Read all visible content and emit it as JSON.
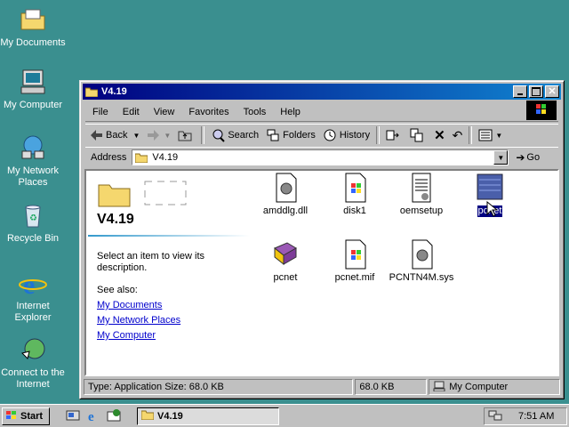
{
  "desktop": {
    "icons": [
      {
        "label": "My Documents",
        "icon": "folder-documents-icon"
      },
      {
        "label": "My Computer",
        "icon": "computer-icon"
      },
      {
        "label": "My Network Places",
        "icon": "network-icon"
      },
      {
        "label": "Recycle Bin",
        "icon": "recycle-bin-icon"
      },
      {
        "label": "Internet Explorer",
        "icon": "internet-explorer-icon"
      },
      {
        "label": "Connect to the Internet",
        "icon": "connect-internet-icon"
      }
    ]
  },
  "window": {
    "title": "V4.19",
    "menu": [
      "File",
      "Edit",
      "View",
      "Favorites",
      "Tools",
      "Help"
    ],
    "toolbar": {
      "back": "Back",
      "search": "Search",
      "folders": "Folders",
      "history": "History"
    },
    "address": {
      "label": "Address",
      "value": "V4.19",
      "go": "Go"
    },
    "sidebar": {
      "folder_name": "V4.19",
      "description": "Select an item to view its description.",
      "see_also": "See also:",
      "links": [
        "My Documents",
        "My Network Places",
        "My Computer"
      ]
    },
    "files": [
      {
        "name": "amddlg.dll",
        "icon": "dll-gear-icon",
        "selected": false
      },
      {
        "name": "disk1",
        "icon": "windows-file-icon",
        "selected": false
      },
      {
        "name": "oemsetup",
        "icon": "setup-info-icon",
        "selected": false
      },
      {
        "name": "pcnet",
        "icon": "application-icon",
        "selected": true
      },
      {
        "name": "pcnet",
        "icon": "help-book-icon",
        "selected": false
      },
      {
        "name": "pcnet.mif",
        "icon": "windows-file-icon",
        "selected": false
      },
      {
        "name": "PCNTN4M.sys",
        "icon": "sys-gear-icon",
        "selected": false
      }
    ],
    "status": {
      "info": "Type: Application Size: 68.0 KB",
      "size": "68.0 KB",
      "zone": "My Computer"
    }
  },
  "taskbar": {
    "start": "Start",
    "task": "V4.19",
    "clock": "7:51 AM"
  },
  "colors": {
    "desktop": "#3a8f8f",
    "title_start": "#000080",
    "title_end": "#1084d0",
    "link": "#0000cc",
    "selection": "#000080"
  }
}
